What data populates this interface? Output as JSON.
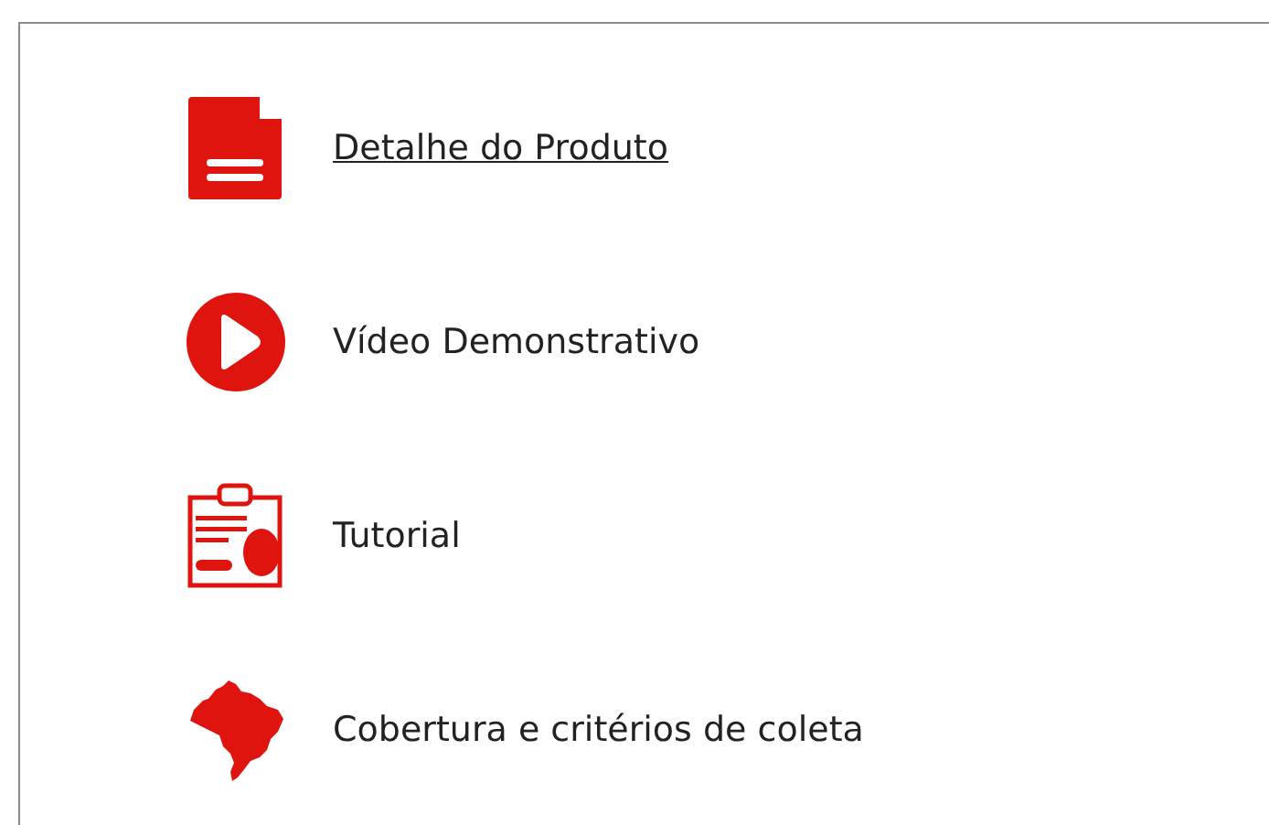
{
  "links": [
    {
      "kind": "document",
      "label": "Detalhe do Produto",
      "underlined": true
    },
    {
      "kind": "video",
      "label": "Vídeo Demonstrativo",
      "underlined": false
    },
    {
      "kind": "tutorial",
      "label": "Tutorial",
      "underlined": false
    },
    {
      "kind": "map",
      "label": "Cobertura e critérios de coleta",
      "underlined": false
    }
  ]
}
